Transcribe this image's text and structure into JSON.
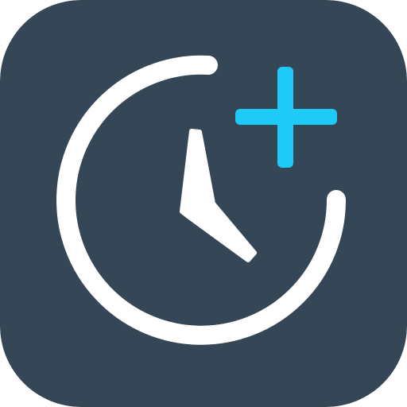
{
  "app_icon": {
    "name": "add-timer-app-icon",
    "icon_symbol": "clock-with-plus-icon",
    "colors": {
      "background": "#354657",
      "clock_stroke": "#ffffff",
      "clock_hands": "#ffffff",
      "plus": "#1ecbf7"
    }
  }
}
